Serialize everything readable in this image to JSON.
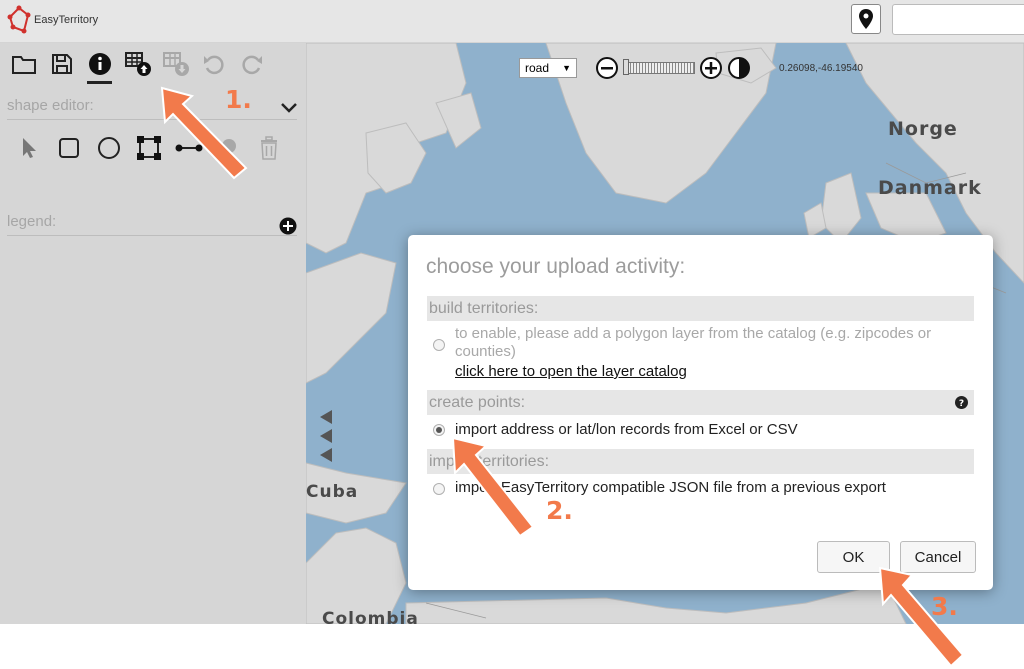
{
  "app": {
    "logo_text": "EasyTerritory"
  },
  "search": {
    "value": "",
    "placeholder": ""
  },
  "left_panel": {
    "shape_editor_label": "shape editor:",
    "legend_label": "legend:"
  },
  "map": {
    "road_select": "road",
    "coords": "0.26098,-46.19540",
    "labels": [
      "Norge",
      "Danmark",
      "Cuba",
      "Colombia"
    ]
  },
  "dialog": {
    "title": "choose your upload activity:",
    "sections": [
      {
        "header": "build territories:",
        "option": "to enable, please add a polygon layer from the catalog (e.g. zipcodes or counties)",
        "link": "click here to open the layer catalog"
      },
      {
        "header": "create points:",
        "option": "import address or lat/lon records from Excel or CSV"
      },
      {
        "header": "import territories:",
        "option": "import EasyTerritory compatible JSON file from a previous export"
      }
    ],
    "ok_label": "OK",
    "cancel_label": "Cancel"
  },
  "annotations": [
    "1.",
    "2.",
    "3."
  ],
  "colors": {
    "annotation": "#f27a4b",
    "map_water": "#8fb1cc",
    "land": "#d8d8d8",
    "logo": "#d0312d"
  }
}
